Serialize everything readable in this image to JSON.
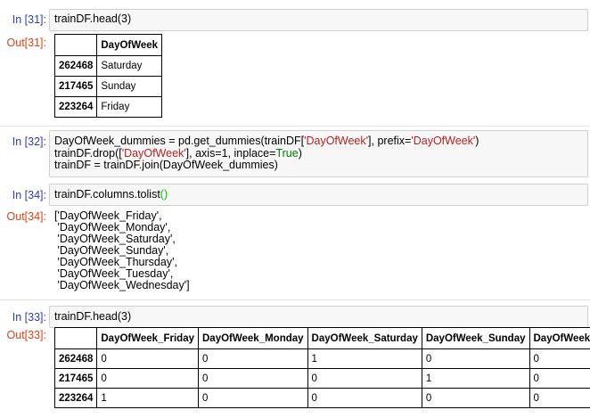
{
  "cells": {
    "c31": {
      "in_prompt": "In [31]:",
      "code": "trainDF.head(3)",
      "out_prompt": "Out[31]:",
      "table": {
        "header": [
          "",
          "DayOfWeek"
        ],
        "rows": [
          [
            "262468",
            "Saturday"
          ],
          [
            "217465",
            "Sunday"
          ],
          [
            "223264",
            "Friday"
          ]
        ]
      }
    },
    "c32": {
      "in_prompt": "In [32]:",
      "line1_a": "DayOfWeek_dummies = pd.get_dummies(trainDF[",
      "line1_s1": "'DayOfWeek'",
      "line1_b": "], prefix=",
      "line1_s2": "'DayOfWeek'",
      "line1_c": ")",
      "line2_a": "trainDF.drop([",
      "line2_s1": "'DayOfWeek'",
      "line2_b": "], axis=1, inplace=",
      "line2_kw": "True",
      "line2_c": ")",
      "line3": "trainDF = trainDF.join(DayOfWeek_dummies)"
    },
    "c34": {
      "in_prompt": "In [34]:",
      "code": "trainDF.columns.tolist",
      "code_paren": "()",
      "out_prompt": "Out[34]:",
      "output_lines": [
        "['DayOfWeek_Friday',",
        " 'DayOfWeek_Monday',",
        " 'DayOfWeek_Saturday',",
        " 'DayOfWeek_Sunday',",
        " 'DayOfWeek_Thursday',",
        " 'DayOfWeek_Tuesday',",
        " 'DayOfWeek_Wednesday']"
      ]
    },
    "c33": {
      "in_prompt": "In [33]:",
      "code": "trainDF.head(3)",
      "out_prompt": "Out[33]:",
      "table": {
        "header": [
          "",
          "DayOfWeek_Friday",
          "DayOfWeek_Monday",
          "DayOfWeek_Saturday",
          "DayOfWeek_Sunday",
          "DayOfWeek_Thu"
        ],
        "rows": [
          [
            "262468",
            "0",
            "0",
            "1",
            "0",
            "0"
          ],
          [
            "217465",
            "0",
            "0",
            "0",
            "1",
            "0"
          ],
          [
            "223264",
            "1",
            "0",
            "0",
            "0",
            "0"
          ]
        ]
      }
    }
  }
}
